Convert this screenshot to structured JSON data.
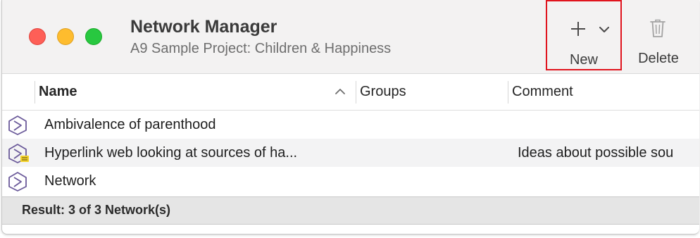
{
  "window": {
    "title": "Network Manager",
    "subtitle": "A9 Sample Project: Children & Happiness"
  },
  "toolbar": {
    "new_label": "New",
    "delete_label": "Delete",
    "new_icon": "plus-icon",
    "new_menu_icon": "chevron-down-icon",
    "delete_icon": "trash-icon"
  },
  "table": {
    "columns": [
      "Name",
      "Groups",
      "Comment"
    ],
    "sort": {
      "column": "Name",
      "direction": "ascending"
    },
    "rows": [
      {
        "name": "Ambivalence of parenthood",
        "groups": "",
        "comment": "",
        "icon": "network-icon",
        "has_memo": false
      },
      {
        "name": "Hyperlink web looking at sources of ha...",
        "groups": "",
        "comment": "Ideas about possible sou",
        "icon": "network-icon",
        "has_memo": true
      },
      {
        "name": "Network",
        "groups": "",
        "comment": "",
        "icon": "network-icon",
        "has_memo": false
      }
    ]
  },
  "status": {
    "result_text": "Result: 3 of 3 Network(s)"
  },
  "colors": {
    "highlight_border": "#e0141e",
    "network_icon": "#6b5a9a",
    "close": "#fe5f57",
    "minimize": "#febc2e",
    "zoom": "#28c840"
  }
}
